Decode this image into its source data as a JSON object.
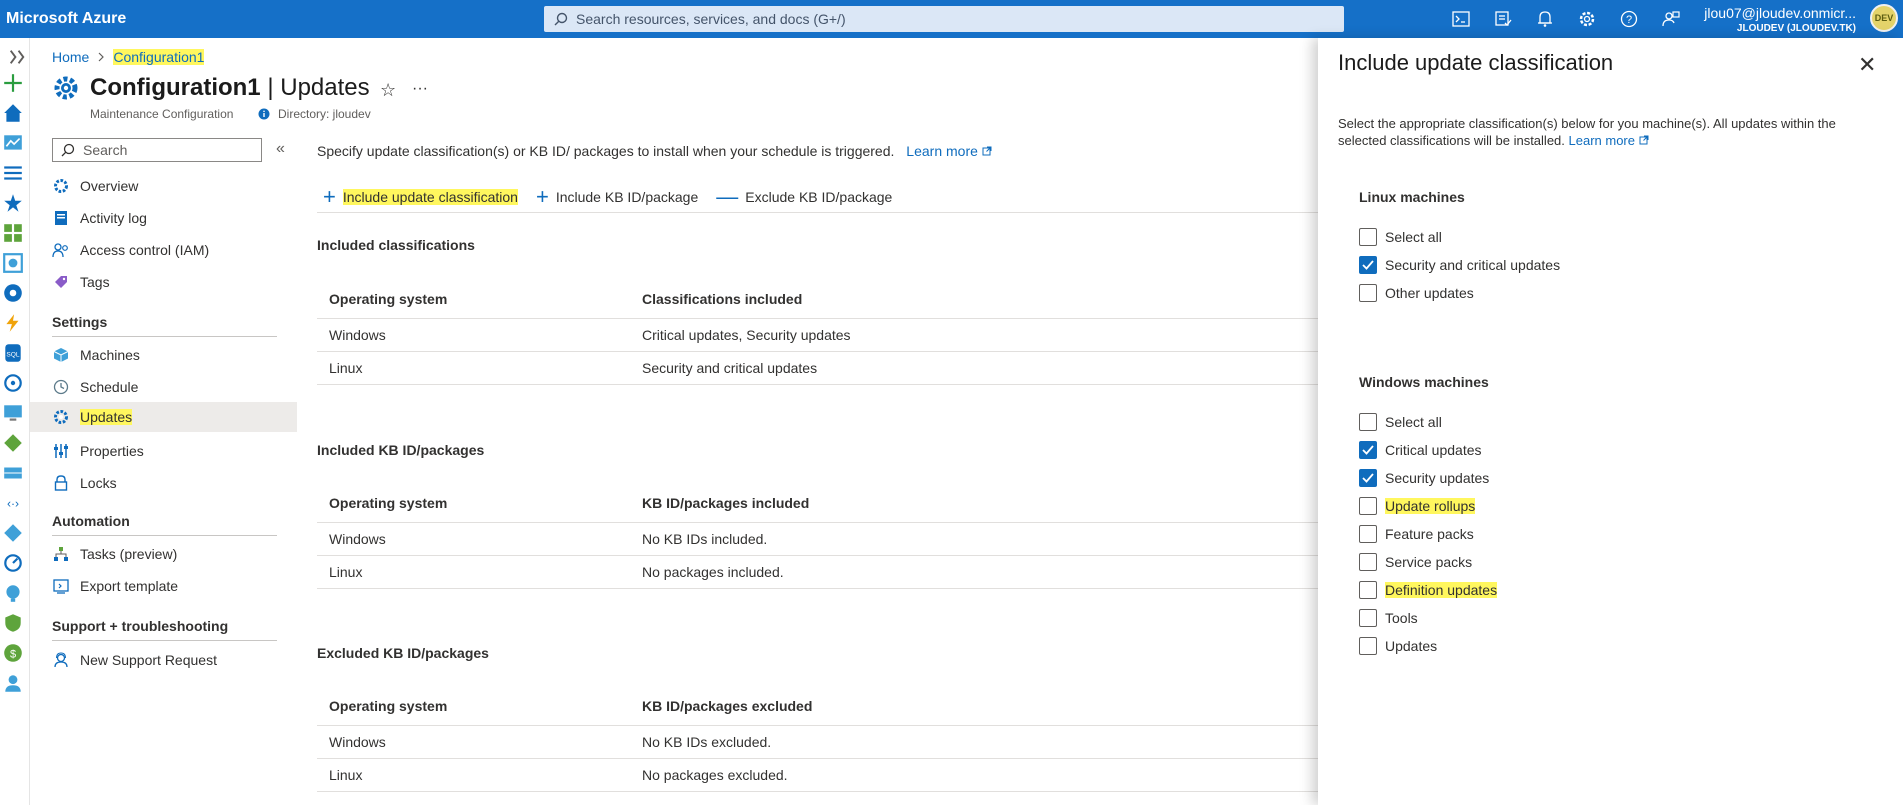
{
  "topbar": {
    "brand": "Microsoft Azure",
    "search_placeholder": "Search resources, services, and docs (G+/)",
    "account_name": "jlou07@jloudev.onmicr...",
    "account_dir": "JLOUDEV (JLOUDEV.TK)",
    "avatar_initials": "DEV"
  },
  "breadcrumb": {
    "home": "Home",
    "current": "Configuration1"
  },
  "header": {
    "title_bold": "Configuration1",
    "title_rest": "| Updates",
    "subtitle": "Maintenance Configuration",
    "directory": "Directory: jloudev"
  },
  "menu": {
    "search_placeholder": "Search",
    "items_top": [
      {
        "label": "Overview"
      },
      {
        "label": "Activity log"
      },
      {
        "label": "Access control (IAM)"
      },
      {
        "label": "Tags"
      }
    ],
    "settings_label": "Settings",
    "settings_items": [
      {
        "label": "Machines"
      },
      {
        "label": "Schedule"
      },
      {
        "label": "Updates"
      },
      {
        "label": "Properties"
      },
      {
        "label": "Locks"
      }
    ],
    "automation_label": "Automation",
    "automation_items": [
      {
        "label": "Tasks (preview)"
      },
      {
        "label": "Export template"
      }
    ],
    "support_label": "Support + troubleshooting",
    "support_items": [
      {
        "label": "New Support Request"
      }
    ]
  },
  "main": {
    "description": "Specify update classification(s) or KB ID/ packages to install when your schedule is triggered.",
    "learn_more": "Learn more",
    "commands": {
      "include_classification": "Include update classification",
      "include_kb": "Include KB ID/package",
      "exclude_kb": "Exclude KB ID/package"
    },
    "included_classifications": {
      "heading": "Included classifications",
      "col1": "Operating system",
      "col2": "Classifications included",
      "rows": [
        {
          "os": "Windows",
          "value": "Critical updates, Security updates"
        },
        {
          "os": "Linux",
          "value": "Security and critical updates"
        }
      ]
    },
    "included_kb": {
      "heading": "Included KB ID/packages",
      "col1": "Operating system",
      "col2": "KB ID/packages included",
      "rows": [
        {
          "os": "Windows",
          "value": "No KB IDs included."
        },
        {
          "os": "Linux",
          "value": "No packages included."
        }
      ]
    },
    "excluded_kb": {
      "heading": "Excluded KB ID/packages",
      "col1": "Operating system",
      "col2": "KB ID/packages excluded",
      "rows": [
        {
          "os": "Windows",
          "value": "No KB IDs excluded."
        },
        {
          "os": "Linux",
          "value": "No packages excluded."
        }
      ]
    }
  },
  "panel": {
    "title": "Include update classification",
    "description": "Select the appropriate classification(s) below for you machine(s). All updates within the selected classifications will be installed.",
    "learn_more": "Learn more",
    "linux_heading": "Linux machines",
    "linux_options": [
      {
        "label": "Select all",
        "checked": false
      },
      {
        "label": "Security and critical updates",
        "checked": true
      },
      {
        "label": "Other updates",
        "checked": false
      }
    ],
    "windows_heading": "Windows machines",
    "windows_options": [
      {
        "label": "Select all",
        "checked": false
      },
      {
        "label": "Critical updates",
        "checked": true
      },
      {
        "label": "Security updates",
        "checked": true
      },
      {
        "label": "Update rollups",
        "checked": false
      },
      {
        "label": "Feature packs",
        "checked": false
      },
      {
        "label": "Service packs",
        "checked": false
      },
      {
        "label": "Definition updates",
        "checked": false
      },
      {
        "label": "Tools",
        "checked": false
      },
      {
        "label": "Updates",
        "checked": false
      }
    ]
  },
  "colors": {
    "brand_bar": "#1570c8",
    "accent": "#0f6cbd",
    "highlight": "#fff75e"
  }
}
